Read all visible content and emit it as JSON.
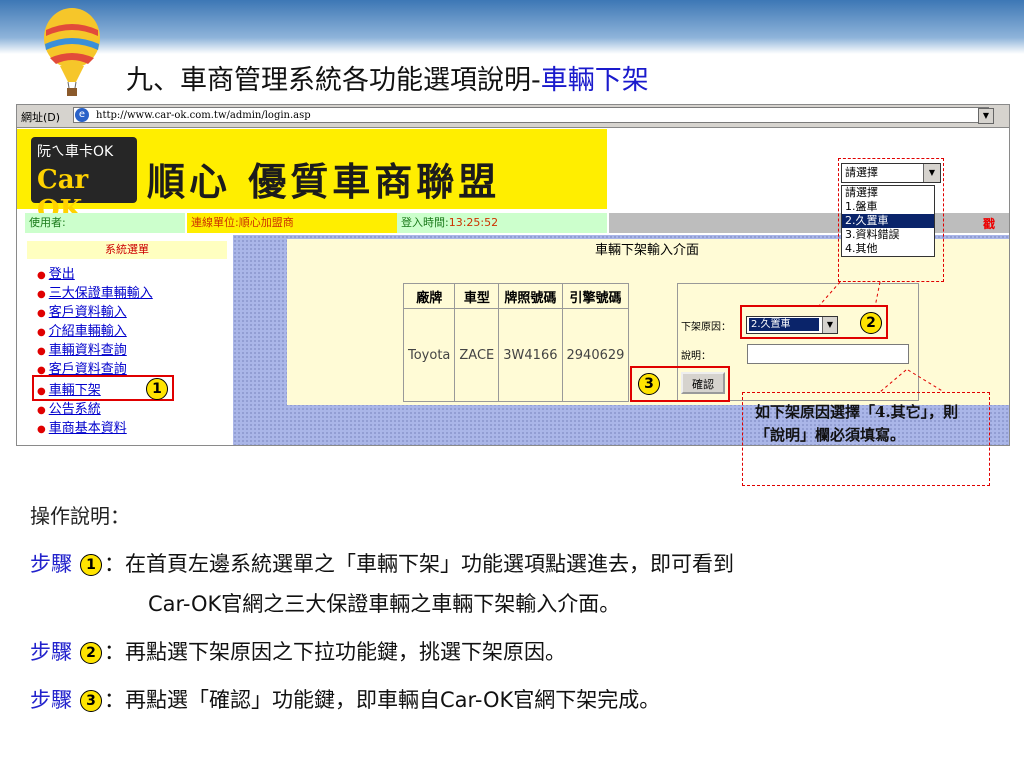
{
  "slide": {
    "title_prefix": "九、車商管理系統各功能選項說明-",
    "title_highlight": "車輛下架"
  },
  "browser": {
    "address_label": "網址(D)",
    "url": "http://www.car-ok.com.tw/admin/login.asp",
    "dropdown_icon": "▼"
  },
  "header": {
    "logo_line1": "阮ㄟ車卡OK",
    "logo_line2": "Car OK",
    "brand": "順心 優質車商聯盟"
  },
  "infobar": {
    "user_label": "使用者:",
    "unit_label": "連線單位:",
    "unit_value": "順心加盟商",
    "time_label": "登入時間:",
    "time_value": "13:25:52",
    "logout_fragment": "戳"
  },
  "menu": {
    "header": "系統選單",
    "items": [
      "登出",
      "三大保證車輛輸入",
      "客戶資料輸入",
      "介紹車輛輸入",
      "車輛資料查詢",
      "客戶資料查詢",
      "車輛下架",
      "公告系統",
      "車商基本資料"
    ]
  },
  "form": {
    "title": "車輛下架輸入介面",
    "columns": [
      "廠牌",
      "車型",
      "牌照號碼",
      "引擎號碼"
    ],
    "row": [
      "Toyota",
      "ZACE",
      "3W4166",
      "2940629"
    ],
    "reason_label": "下架原因：",
    "reason_selected": "2.久置車",
    "desc_label": "說明：",
    "desc_value": "",
    "confirm_label": "確認"
  },
  "dropdown": {
    "selected": "請選擇",
    "options": [
      "請選擇",
      "1.盤車",
      "2.久置車",
      "3.資料錯誤",
      "4.其他"
    ],
    "highlighted_index": 2
  },
  "markers": {
    "m1": "1",
    "m2": "2",
    "m3": "3"
  },
  "callout": {
    "text": "如下架原因選擇「4.其它」，則「說明」欄必須填寫。"
  },
  "instructions": {
    "heading": "操作說明：",
    "step_label": "步驟",
    "step1_line1": "：在首頁左邊系統選單之「車輛下架」功能選項點選進去，即可看到",
    "step1_line2": "Car-OK官網之三大保證車輛之車輛下架輸入介面。",
    "step2": "：再點選下架原因之下拉功能鍵，挑選下架原因。",
    "step3": "：再點選「確認」功能鍵，即車輛自Car-OK官網下架完成。"
  },
  "colors": {
    "title_highlight": "#1a1acc",
    "marker": "#ffe400",
    "highlight_border": "#e00000",
    "step_label": "#2222cc"
  }
}
